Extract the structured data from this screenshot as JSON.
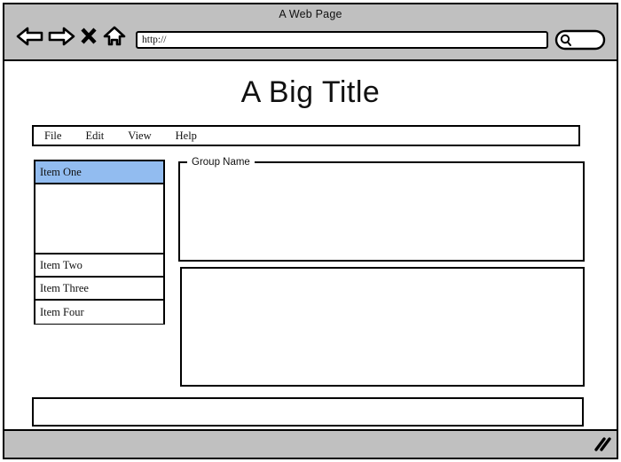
{
  "browser": {
    "window_title": "A Web Page",
    "nav": [
      {
        "name": "back-icon",
        "label": "Back"
      },
      {
        "name": "forward-icon",
        "label": "Forward"
      },
      {
        "name": "stop-icon",
        "label": "Stop"
      },
      {
        "name": "home-icon",
        "label": "Home"
      }
    ],
    "url_value": "http://",
    "url_placeholder": "http://",
    "search_placeholder": "",
    "search_value": "",
    "search_icon": "magnifier-icon"
  },
  "page": {
    "title": "A Big Title"
  },
  "menu": {
    "items": [
      {
        "label": "File"
      },
      {
        "label": "Edit"
      },
      {
        "label": "View"
      },
      {
        "label": "Help"
      }
    ]
  },
  "list": {
    "rows": [
      {
        "label": "Item One",
        "selected": true
      },
      {
        "label": "",
        "selected": false,
        "filler": true
      },
      {
        "label": "Item Two",
        "selected": false
      },
      {
        "label": "Item Three",
        "selected": false
      },
      {
        "label": "Item Four",
        "selected": false
      }
    ]
  },
  "group_box": {
    "legend": "Group Name",
    "content": ""
  },
  "panel_lower": {
    "content": ""
  },
  "panel_bottom": {
    "content": ""
  },
  "status_bar": {
    "text": "",
    "grip_icon": "resize-grip-icon"
  },
  "colors": {
    "chrome": "#c0c0c0",
    "border": "#000000",
    "selection": "#92bcf0",
    "canvas": "#ffffff",
    "text": "#111111"
  }
}
